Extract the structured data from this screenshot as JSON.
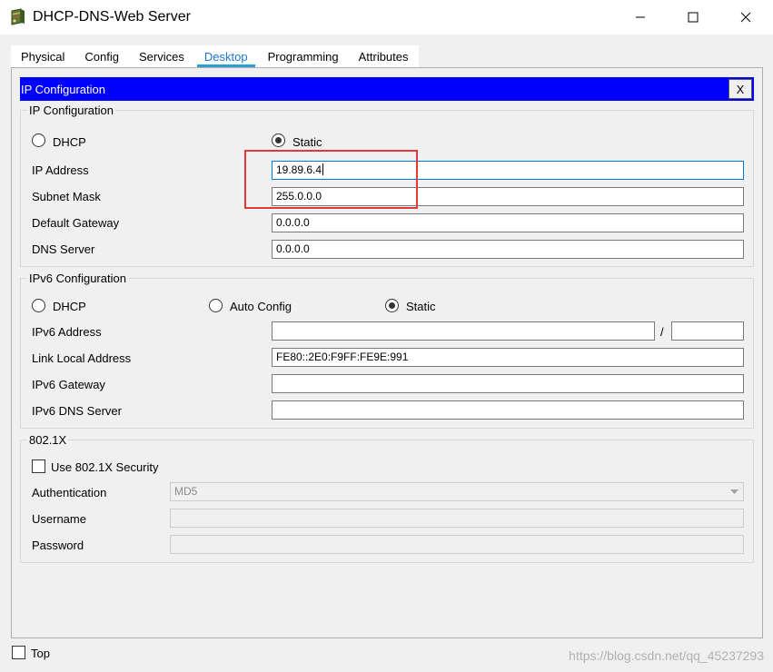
{
  "window": {
    "title": "DHCP-DNS-Web Server",
    "app_icon": "packet-tracer-server-icon",
    "minimize_icon": "minimize-icon",
    "maximize_icon": "maximize-icon",
    "close_icon": "close-icon"
  },
  "tabs": [
    {
      "label": "Physical",
      "active": false
    },
    {
      "label": "Config",
      "active": false
    },
    {
      "label": "Services",
      "active": false
    },
    {
      "label": "Desktop",
      "active": true
    },
    {
      "label": "Programming",
      "active": false
    },
    {
      "label": "Attributes",
      "active": false
    }
  ],
  "panel": {
    "title": "IP Configuration",
    "close_label": "X",
    "header_color": "#0000ff"
  },
  "ipv4": {
    "legend": "IP Configuration",
    "dhcp_label": "DHCP",
    "static_label": "Static",
    "selected_mode": "Static",
    "ip_address_label": "IP Address",
    "ip_address_value": "19.89.6.4",
    "subnet_mask_label": "Subnet Mask",
    "subnet_mask_value": "255.0.0.0",
    "default_gateway_label": "Default Gateway",
    "default_gateway_value": "0.0.0.0",
    "dns_server_label": "DNS Server",
    "dns_server_value": "0.0.0.0"
  },
  "ipv6": {
    "legend": "IPv6 Configuration",
    "dhcp_label": "DHCP",
    "auto_config_label": "Auto Config",
    "static_label": "Static",
    "selected_mode": "Static",
    "address_label": "IPv6 Address",
    "address_value": "",
    "prefix_separator": "/",
    "prefix_value": "",
    "link_local_label": "Link Local Address",
    "link_local_value": "FE80::2E0:F9FF:FE9E:991",
    "gateway_label": "IPv6 Gateway",
    "gateway_value": "",
    "dns_server_label": "IPv6 DNS Server",
    "dns_server_value": ""
  },
  "dot1x": {
    "legend": "802.1X",
    "use_security_label": "Use 802.1X Security",
    "use_security_checked": false,
    "authentication_label": "Authentication",
    "authentication_value": "MD5",
    "username_label": "Username",
    "username_value": "",
    "password_label": "Password",
    "password_value": ""
  },
  "footer": {
    "top_label": "Top",
    "top_checked": false
  },
  "watermark": "https://blog.csdn.net/qq_45237293",
  "colors": {
    "highlight": "#e53935",
    "active_tab": "#1976d2",
    "tab_underline": "#2a9fd6"
  }
}
